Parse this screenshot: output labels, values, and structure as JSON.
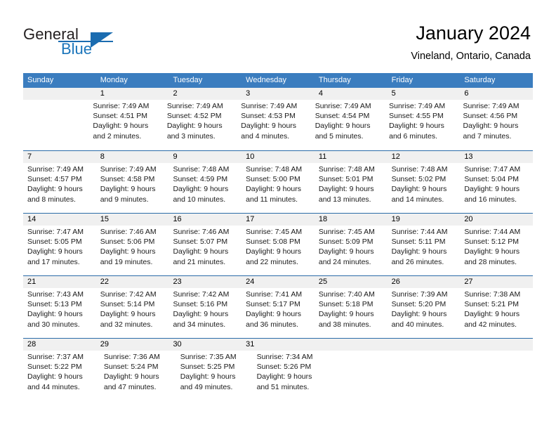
{
  "brand": {
    "name_part1": "General",
    "name_part2": "Blue",
    "logo_icon": "blue-triangle-icon",
    "primary_color": "#1b6cb0"
  },
  "header": {
    "title": "January 2024",
    "location": "Vineland, Ontario, Canada"
  },
  "calendar": {
    "header_bg": "#3b7dbf",
    "daynumber_bg": "#f0f0f0",
    "weekdays": [
      "Sunday",
      "Monday",
      "Tuesday",
      "Wednesday",
      "Thursday",
      "Friday",
      "Saturday"
    ],
    "weeks": [
      {
        "days": [
          {
            "num": "",
            "sunrise": "",
            "sunset": "",
            "daylight1": "",
            "daylight2": ""
          },
          {
            "num": "1",
            "sunrise": "Sunrise: 7:49 AM",
            "sunset": "Sunset: 4:51 PM",
            "daylight1": "Daylight: 9 hours",
            "daylight2": "and 2 minutes."
          },
          {
            "num": "2",
            "sunrise": "Sunrise: 7:49 AM",
            "sunset": "Sunset: 4:52 PM",
            "daylight1": "Daylight: 9 hours",
            "daylight2": "and 3 minutes."
          },
          {
            "num": "3",
            "sunrise": "Sunrise: 7:49 AM",
            "sunset": "Sunset: 4:53 PM",
            "daylight1": "Daylight: 9 hours",
            "daylight2": "and 4 minutes."
          },
          {
            "num": "4",
            "sunrise": "Sunrise: 7:49 AM",
            "sunset": "Sunset: 4:54 PM",
            "daylight1": "Daylight: 9 hours",
            "daylight2": "and 5 minutes."
          },
          {
            "num": "5",
            "sunrise": "Sunrise: 7:49 AM",
            "sunset": "Sunset: 4:55 PM",
            "daylight1": "Daylight: 9 hours",
            "daylight2": "and 6 minutes."
          },
          {
            "num": "6",
            "sunrise": "Sunrise: 7:49 AM",
            "sunset": "Sunset: 4:56 PM",
            "daylight1": "Daylight: 9 hours",
            "daylight2": "and 7 minutes."
          }
        ]
      },
      {
        "days": [
          {
            "num": "7",
            "sunrise": "Sunrise: 7:49 AM",
            "sunset": "Sunset: 4:57 PM",
            "daylight1": "Daylight: 9 hours",
            "daylight2": "and 8 minutes."
          },
          {
            "num": "8",
            "sunrise": "Sunrise: 7:49 AM",
            "sunset": "Sunset: 4:58 PM",
            "daylight1": "Daylight: 9 hours",
            "daylight2": "and 9 minutes."
          },
          {
            "num": "9",
            "sunrise": "Sunrise: 7:48 AM",
            "sunset": "Sunset: 4:59 PM",
            "daylight1": "Daylight: 9 hours",
            "daylight2": "and 10 minutes."
          },
          {
            "num": "10",
            "sunrise": "Sunrise: 7:48 AM",
            "sunset": "Sunset: 5:00 PM",
            "daylight1": "Daylight: 9 hours",
            "daylight2": "and 11 minutes."
          },
          {
            "num": "11",
            "sunrise": "Sunrise: 7:48 AM",
            "sunset": "Sunset: 5:01 PM",
            "daylight1": "Daylight: 9 hours",
            "daylight2": "and 13 minutes."
          },
          {
            "num": "12",
            "sunrise": "Sunrise: 7:48 AM",
            "sunset": "Sunset: 5:02 PM",
            "daylight1": "Daylight: 9 hours",
            "daylight2": "and 14 minutes."
          },
          {
            "num": "13",
            "sunrise": "Sunrise: 7:47 AM",
            "sunset": "Sunset: 5:04 PM",
            "daylight1": "Daylight: 9 hours",
            "daylight2": "and 16 minutes."
          }
        ]
      },
      {
        "days": [
          {
            "num": "14",
            "sunrise": "Sunrise: 7:47 AM",
            "sunset": "Sunset: 5:05 PM",
            "daylight1": "Daylight: 9 hours",
            "daylight2": "and 17 minutes."
          },
          {
            "num": "15",
            "sunrise": "Sunrise: 7:46 AM",
            "sunset": "Sunset: 5:06 PM",
            "daylight1": "Daylight: 9 hours",
            "daylight2": "and 19 minutes."
          },
          {
            "num": "16",
            "sunrise": "Sunrise: 7:46 AM",
            "sunset": "Sunset: 5:07 PM",
            "daylight1": "Daylight: 9 hours",
            "daylight2": "and 21 minutes."
          },
          {
            "num": "17",
            "sunrise": "Sunrise: 7:45 AM",
            "sunset": "Sunset: 5:08 PM",
            "daylight1": "Daylight: 9 hours",
            "daylight2": "and 22 minutes."
          },
          {
            "num": "18",
            "sunrise": "Sunrise: 7:45 AM",
            "sunset": "Sunset: 5:09 PM",
            "daylight1": "Daylight: 9 hours",
            "daylight2": "and 24 minutes."
          },
          {
            "num": "19",
            "sunrise": "Sunrise: 7:44 AM",
            "sunset": "Sunset: 5:11 PM",
            "daylight1": "Daylight: 9 hours",
            "daylight2": "and 26 minutes."
          },
          {
            "num": "20",
            "sunrise": "Sunrise: 7:44 AM",
            "sunset": "Sunset: 5:12 PM",
            "daylight1": "Daylight: 9 hours",
            "daylight2": "and 28 minutes."
          }
        ]
      },
      {
        "days": [
          {
            "num": "21",
            "sunrise": "Sunrise: 7:43 AM",
            "sunset": "Sunset: 5:13 PM",
            "daylight1": "Daylight: 9 hours",
            "daylight2": "and 30 minutes."
          },
          {
            "num": "22",
            "sunrise": "Sunrise: 7:42 AM",
            "sunset": "Sunset: 5:14 PM",
            "daylight1": "Daylight: 9 hours",
            "daylight2": "and 32 minutes."
          },
          {
            "num": "23",
            "sunrise": "Sunrise: 7:42 AM",
            "sunset": "Sunset: 5:16 PM",
            "daylight1": "Daylight: 9 hours",
            "daylight2": "and 34 minutes."
          },
          {
            "num": "24",
            "sunrise": "Sunrise: 7:41 AM",
            "sunset": "Sunset: 5:17 PM",
            "daylight1": "Daylight: 9 hours",
            "daylight2": "and 36 minutes."
          },
          {
            "num": "25",
            "sunrise": "Sunrise: 7:40 AM",
            "sunset": "Sunset: 5:18 PM",
            "daylight1": "Daylight: 9 hours",
            "daylight2": "and 38 minutes."
          },
          {
            "num": "26",
            "sunrise": "Sunrise: 7:39 AM",
            "sunset": "Sunset: 5:20 PM",
            "daylight1": "Daylight: 9 hours",
            "daylight2": "and 40 minutes."
          },
          {
            "num": "27",
            "sunrise": "Sunrise: 7:38 AM",
            "sunset": "Sunset: 5:21 PM",
            "daylight1": "Daylight: 9 hours",
            "daylight2": "and 42 minutes."
          }
        ]
      },
      {
        "days": [
          {
            "num": "28",
            "sunrise": "Sunrise: 7:37 AM",
            "sunset": "Sunset: 5:22 PM",
            "daylight1": "Daylight: 9 hours",
            "daylight2": "and 44 minutes."
          },
          {
            "num": "29",
            "sunrise": "Sunrise: 7:36 AM",
            "sunset": "Sunset: 5:24 PM",
            "daylight1": "Daylight: 9 hours",
            "daylight2": "and 47 minutes."
          },
          {
            "num": "30",
            "sunrise": "Sunrise: 7:35 AM",
            "sunset": "Sunset: 5:25 PM",
            "daylight1": "Daylight: 9 hours",
            "daylight2": "and 49 minutes."
          },
          {
            "num": "31",
            "sunrise": "Sunrise: 7:34 AM",
            "sunset": "Sunset: 5:26 PM",
            "daylight1": "Daylight: 9 hours",
            "daylight2": "and 51 minutes."
          },
          {
            "num": "",
            "sunrise": "",
            "sunset": "",
            "daylight1": "",
            "daylight2": ""
          },
          {
            "num": "",
            "sunrise": "",
            "sunset": "",
            "daylight1": "",
            "daylight2": ""
          },
          {
            "num": "",
            "sunrise": "",
            "sunset": "",
            "daylight1": "",
            "daylight2": ""
          }
        ]
      }
    ]
  }
}
